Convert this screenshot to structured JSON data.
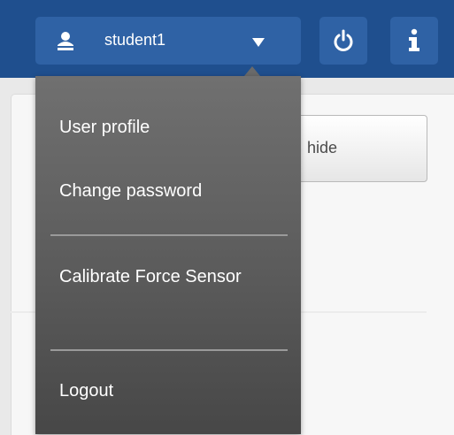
{
  "header": {
    "username": "student1",
    "user_icon": "user-icon",
    "caret_icon": "caret-down-icon",
    "power_icon": "power-icon",
    "info_icon": "info-icon",
    "colors": {
      "bar": "#1f4f8e",
      "button": "#2f62a5"
    }
  },
  "content": {
    "hide_button_label": "hide"
  },
  "user_menu": {
    "items": [
      {
        "label": "User profile"
      },
      {
        "label": "Change password"
      },
      {
        "label": "Calibrate Force Sensor"
      },
      {
        "label": "Logout"
      }
    ],
    "background": "#5b5b5b"
  }
}
